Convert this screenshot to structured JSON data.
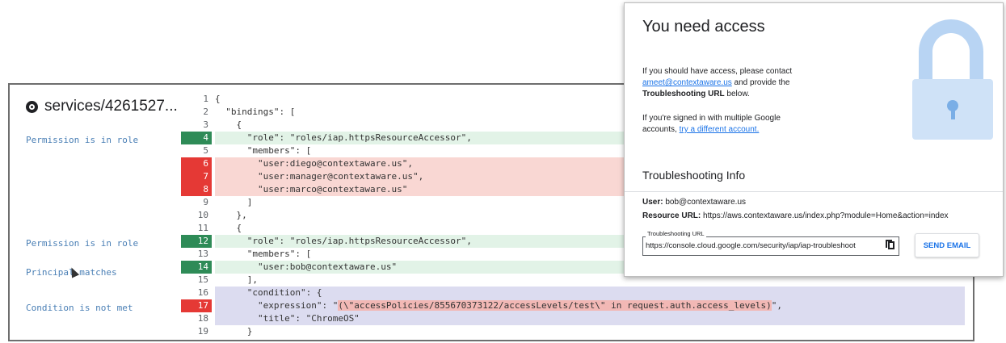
{
  "troubleshooter": {
    "service_title": "services/4261527...",
    "annotations": [
      "Permission is in role",
      "Permission is in role",
      "Principal matches",
      "Condition is not met"
    ],
    "code_lines": [
      {
        "num": "1",
        "text": "{"
      },
      {
        "num": "2",
        "text": "  \"bindings\": ["
      },
      {
        "num": "3",
        "text": "    {"
      },
      {
        "num": "4",
        "text": "      \"role\": \"roles/iap.httpsResourceAccessor\","
      },
      {
        "num": "5",
        "text": "      \"members\": ["
      },
      {
        "num": "6",
        "text": "        \"user:diego@contextaware.us\","
      },
      {
        "num": "7",
        "text": "        \"user:manager@contextaware.us\","
      },
      {
        "num": "8",
        "text": "        \"user:marco@contextaware.us\""
      },
      {
        "num": "9",
        "text": "      ]"
      },
      {
        "num": "10",
        "text": "    },"
      },
      {
        "num": "11",
        "text": "    {"
      },
      {
        "num": "12",
        "text": "      \"role\": \"roles/iap.httpsResourceAccessor\","
      },
      {
        "num": "13",
        "text": "      \"members\": ["
      },
      {
        "num": "14",
        "text": "        \"user:bob@contextaware.us\""
      },
      {
        "num": "15",
        "text": "      ],"
      },
      {
        "num": "16",
        "text": "      \"condition\": {"
      },
      {
        "num": "17a",
        "text": "        \"expression\": \""
      },
      {
        "num": "17b",
        "text": "(\\\"accessPolicies/855670373122/accessLevels/test\\\" in request.auth.access_levels)"
      },
      {
        "num": "17c",
        "text": "\","
      },
      {
        "num": "18",
        "text": "        \"title\": \"ChromeOS\""
      },
      {
        "num": "19",
        "text": "      }"
      }
    ]
  },
  "access_dialog": {
    "title": "You need access",
    "para1_pre": "If you should have access, please contact",
    "para1_link": "ameet@contextaware.us",
    "para1_mid": " and provide the",
    "para1_bold": "Troubleshooting URL",
    "para1_post": " below.",
    "para2_pre": "If you're signed in with multiple Google",
    "para2_mid": "accounts, ",
    "para2_link": "try a different account.",
    "ts_title": "Troubleshooting Info",
    "user_label": "User:",
    "user_value": "bob@contextaware.us",
    "resource_label": "Resource URL:",
    "resource_value": "https://aws.contextaware.us/index.php?module=Home&action=index",
    "url_field_label": "Troubleshooting URL",
    "url_field_value": "https://console.cloud.google.com/security/iap/iap-troubleshoot",
    "send_button": "SEND EMAIL"
  },
  "colors": {
    "green_line": "#2e8b57",
    "red_line": "#e53935",
    "link_blue": "#1a73e8",
    "annotation_blue": "#4a7fb5"
  }
}
